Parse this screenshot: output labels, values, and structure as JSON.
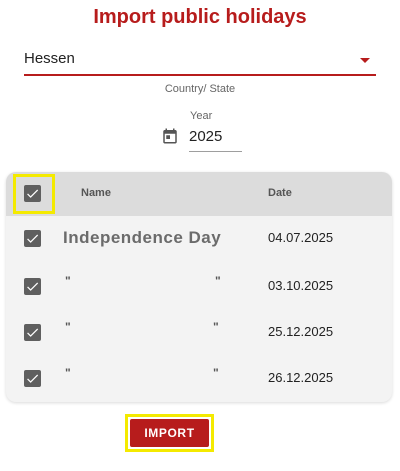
{
  "dialog": {
    "title": "Import public holidays"
  },
  "country_select": {
    "value": "Hessen",
    "hint": "Country/ State",
    "accent": "#b71c1c"
  },
  "year_field": {
    "label": "Year",
    "value": "2025",
    "icon": "calendar-icon"
  },
  "table": {
    "columns": {
      "name": "Name",
      "date": "Date"
    },
    "select_all_checked": true,
    "rows": [
      {
        "checked": true,
        "name": "Independence Day",
        "date": "04.07.2025"
      },
      {
        "checked": true,
        "name_open": "\"",
        "name_close": "\"",
        "date": "03.10.2025"
      },
      {
        "checked": true,
        "name_open": "\"",
        "name_close": "\"",
        "date": "25.12.2025"
      },
      {
        "checked": true,
        "name_open": "\"",
        "name_close": "\"",
        "date": "26.12.2025"
      }
    ]
  },
  "actions": {
    "import_label": "IMPORT"
  },
  "colors": {
    "brand": "#b71c1c",
    "highlight": "#f4ea00",
    "checkbox": "#5f5f5f"
  }
}
